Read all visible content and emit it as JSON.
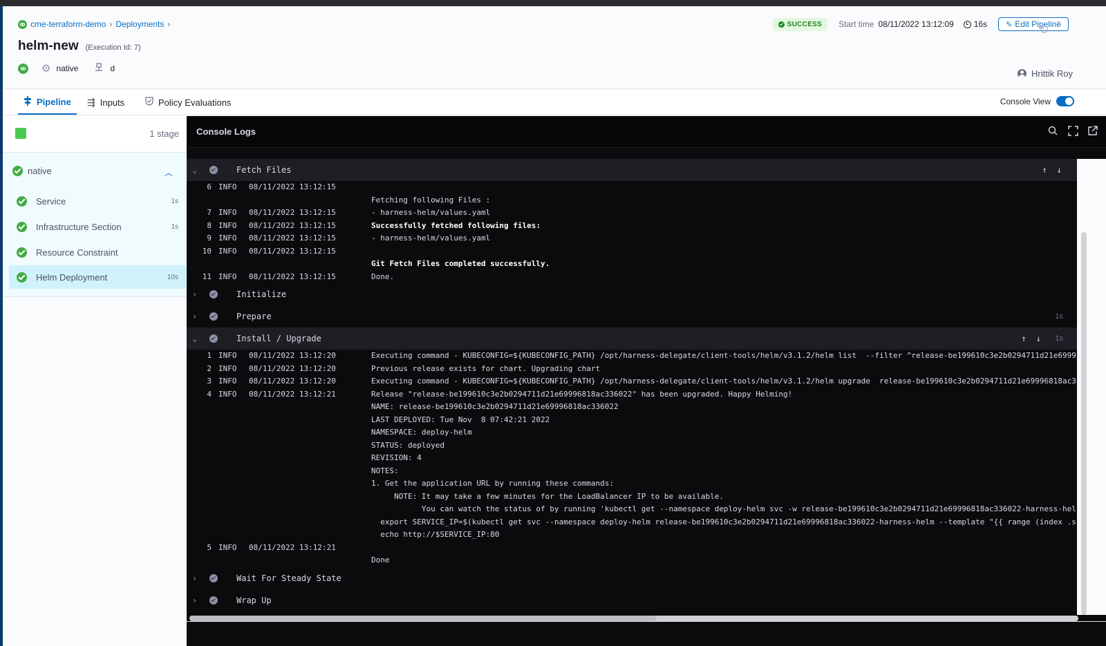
{
  "header": {
    "breadcrumb": [
      {
        "label": "cme-terraform-demo"
      },
      {
        "label": "Deployments"
      }
    ],
    "pipeline_name": "helm-new",
    "execution_id": "(Execution Id: 7)",
    "service_type": "native",
    "infrastructure": "d",
    "status": "SUCCESS",
    "start_time_label": "Start time",
    "start_time": "08/11/2022 13:12:09",
    "duration": "16s",
    "edit_button": "Edit Pipeline",
    "user": "Hrittik Roy"
  },
  "tabs": [
    {
      "label": "Pipeline",
      "icon": "pipeline-icon",
      "active": true
    },
    {
      "label": "Inputs",
      "icon": "inputs-icon",
      "active": false
    },
    {
      "label": "Policy Evaluations",
      "icon": "policy-icon",
      "active": false
    }
  ],
  "console_view": {
    "label": "Console View",
    "enabled": true
  },
  "sidebar": {
    "stage_count": "1 stage",
    "stage": {
      "name": "native",
      "status": "success",
      "expanded": true
    },
    "steps": [
      {
        "name": "Service",
        "duration": "1s",
        "active": false
      },
      {
        "name": "Infrastructure Section",
        "duration": "1s",
        "active": false
      },
      {
        "name": "Resource Constraint",
        "duration": "",
        "active": false
      },
      {
        "name": "Helm Deployment",
        "duration": "10s",
        "active": true
      }
    ]
  },
  "console": {
    "title": "Console Logs",
    "sections": [
      {
        "name": "Fetch Files",
        "expanded": true,
        "duration": "",
        "lines": [
          {
            "num": "6",
            "level": "INFO",
            "ts": "08/11/2022 13:12:15",
            "msg": "",
            "bold": false
          },
          {
            "num": "",
            "level": "",
            "ts": "",
            "msg": "Fetching following Files :",
            "bold": false
          },
          {
            "num": "7",
            "level": "INFO",
            "ts": "08/11/2022 13:12:15",
            "msg": "- harness-helm/values.yaml",
            "bold": false
          },
          {
            "num": "8",
            "level": "INFO",
            "ts": "08/11/2022 13:12:15",
            "msg": "Successfully fetched following files:",
            "bold": true
          },
          {
            "num": "9",
            "level": "INFO",
            "ts": "08/11/2022 13:12:15",
            "msg": "- harness-helm/values.yaml",
            "bold": false
          },
          {
            "num": "10",
            "level": "INFO",
            "ts": "08/11/2022 13:12:15",
            "msg": "",
            "bold": false
          },
          {
            "num": "",
            "level": "",
            "ts": "",
            "msg": "Git Fetch Files completed successfully.",
            "bold": true
          },
          {
            "num": "11",
            "level": "INFO",
            "ts": "08/11/2022 13:12:15",
            "msg": "Done.",
            "bold": false
          }
        ]
      },
      {
        "name": "Initialize",
        "expanded": false,
        "duration": "",
        "lines": []
      },
      {
        "name": "Prepare",
        "expanded": false,
        "duration": "1s",
        "lines": []
      },
      {
        "name": "Install / Upgrade",
        "expanded": true,
        "duration": "1s",
        "lines": [
          {
            "num": "1",
            "level": "INFO",
            "ts": "08/11/2022 13:12:20",
            "msg": "Executing command - KUBECONFIG=${KUBECONFIG_PATH} /opt/harness-delegate/client-tools/helm/v3.1.2/helm list  --filter ^release-be199610c3e2b0294711d21e6999",
            "bold": false
          },
          {
            "num": "2",
            "level": "INFO",
            "ts": "08/11/2022 13:12:20",
            "msg": "Previous release exists for chart. Upgrading chart",
            "bold": false
          },
          {
            "num": "3",
            "level": "INFO",
            "ts": "08/11/2022 13:12:20",
            "msg": "Executing command - KUBECONFIG=${KUBECONFIG_PATH} /opt/harness-delegate/client-tools/helm/v3.1.2/helm upgrade  release-be199610c3e2b0294711d21e69996818ac3",
            "bold": false
          },
          {
            "num": "4",
            "level": "INFO",
            "ts": "08/11/2022 13:12:21",
            "msg": "Release \"release-be199610c3e2b0294711d21e69996818ac336022\" has been upgraded. Happy Helming!",
            "bold": false
          },
          {
            "num": "",
            "level": "",
            "ts": "",
            "msg": "NAME: release-be199610c3e2b0294711d21e69996818ac336022",
            "bold": false
          },
          {
            "num": "",
            "level": "",
            "ts": "",
            "msg": "LAST DEPLOYED: Tue Nov  8 07:42:21 2022",
            "bold": false
          },
          {
            "num": "",
            "level": "",
            "ts": "",
            "msg": "NAMESPACE: deploy-helm",
            "bold": false
          },
          {
            "num": "",
            "level": "",
            "ts": "",
            "msg": "STATUS: deployed",
            "bold": false
          },
          {
            "num": "",
            "level": "",
            "ts": "",
            "msg": "REVISION: 4",
            "bold": false
          },
          {
            "num": "",
            "level": "",
            "ts": "",
            "msg": "NOTES:",
            "bold": false
          },
          {
            "num": "",
            "level": "",
            "ts": "",
            "msg": "1. Get the application URL by running these commands:",
            "bold": false
          },
          {
            "num": "",
            "level": "",
            "ts": "",
            "msg": "     NOTE: It may take a few minutes for the LoadBalancer IP to be available.",
            "bold": false
          },
          {
            "num": "",
            "level": "",
            "ts": "",
            "msg": "           You can watch the status of by running 'kubectl get --namespace deploy-helm svc -w release-be199610c3e2b0294711d21e69996818ac336022-harness-hel",
            "bold": false
          },
          {
            "num": "",
            "level": "",
            "ts": "",
            "msg": "  export SERVICE_IP=$(kubectl get svc --namespace deploy-helm release-be199610c3e2b0294711d21e69996818ac336022-harness-helm --template \"{{ range (index .s",
            "bold": false
          },
          {
            "num": "",
            "level": "",
            "ts": "",
            "msg": "  echo http://$SERVICE_IP:80",
            "bold": false
          },
          {
            "num": "5",
            "level": "INFO",
            "ts": "08/11/2022 13:12:21",
            "msg": "",
            "bold": false
          },
          {
            "num": "",
            "level": "",
            "ts": "",
            "msg": "Done",
            "bold": false
          }
        ]
      },
      {
        "name": "Wait For Steady State",
        "expanded": false,
        "duration": "",
        "lines": []
      },
      {
        "name": "Wrap Up",
        "expanded": false,
        "duration": "",
        "lines": []
      }
    ]
  }
}
